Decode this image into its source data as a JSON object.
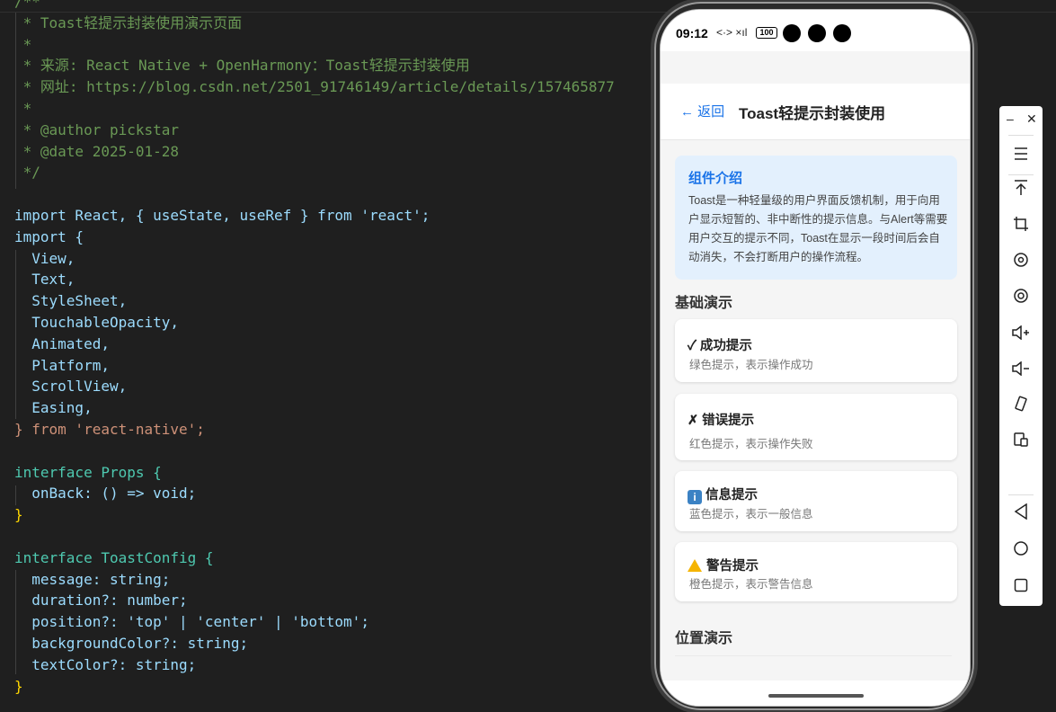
{
  "code": {
    "lines": [
      "/**",
      " * Toast轻提示封装使用演示页面",
      " *",
      " * 来源: React Native + OpenHarmony：Toast轻提示封装使用",
      " * 网址: https://blog.csdn.net/2501_91746149/article/details/157465877",
      " *",
      " * @author pickstar",
      " * @date 2025-01-28",
      " */",
      "",
      "import React, { useState, useRef } from 'react';",
      "import {",
      "  View,",
      "  Text,",
      "  StyleSheet,",
      "  TouchableOpacity,",
      "  Animated,",
      "  Platform,",
      "  ScrollView,",
      "  Easing,",
      "} from 'react-native';",
      "",
      "interface Props {",
      "  onBack: () => void;",
      "}",
      "",
      "interface ToastConfig {",
      "  message: string;",
      "  duration?: number;",
      "  position?: 'top' | 'center' | 'bottom';",
      "  backgroundColor?: string;",
      "  textColor?: string;",
      "}"
    ]
  },
  "phone": {
    "status": {
      "time": "09:12",
      "signal": "<·> ×ıl",
      "battery": "100"
    },
    "header": {
      "back": "← 返回",
      "title": "Toast轻提示封装使用"
    },
    "intro": {
      "title": "组件介绍",
      "text": "Toast是一种轻量级的用户界面反馈机制，用于向用户显示短暂的、非中断性的提示信息。与Alert等需要用户交互的提示不同，Toast在显示一段时间后会自动消失，不会打断用户的操作流程。"
    },
    "section_basic": "基础演示",
    "cards": [
      {
        "title": "✓ 成功提示",
        "sub": "绿色提示，表示操作成功"
      },
      {
        "title": "✗ 错误提示",
        "sub": "红色提示，表示操作失败"
      },
      {
        "title": "信息提示",
        "sub": "蓝色提示，表示一般信息"
      },
      {
        "title": "警告提示",
        "sub": "橙色提示，表示警告信息"
      }
    ],
    "section_position": "位置演示"
  },
  "toolbar": {
    "minimize": "‒",
    "close": "✕"
  }
}
